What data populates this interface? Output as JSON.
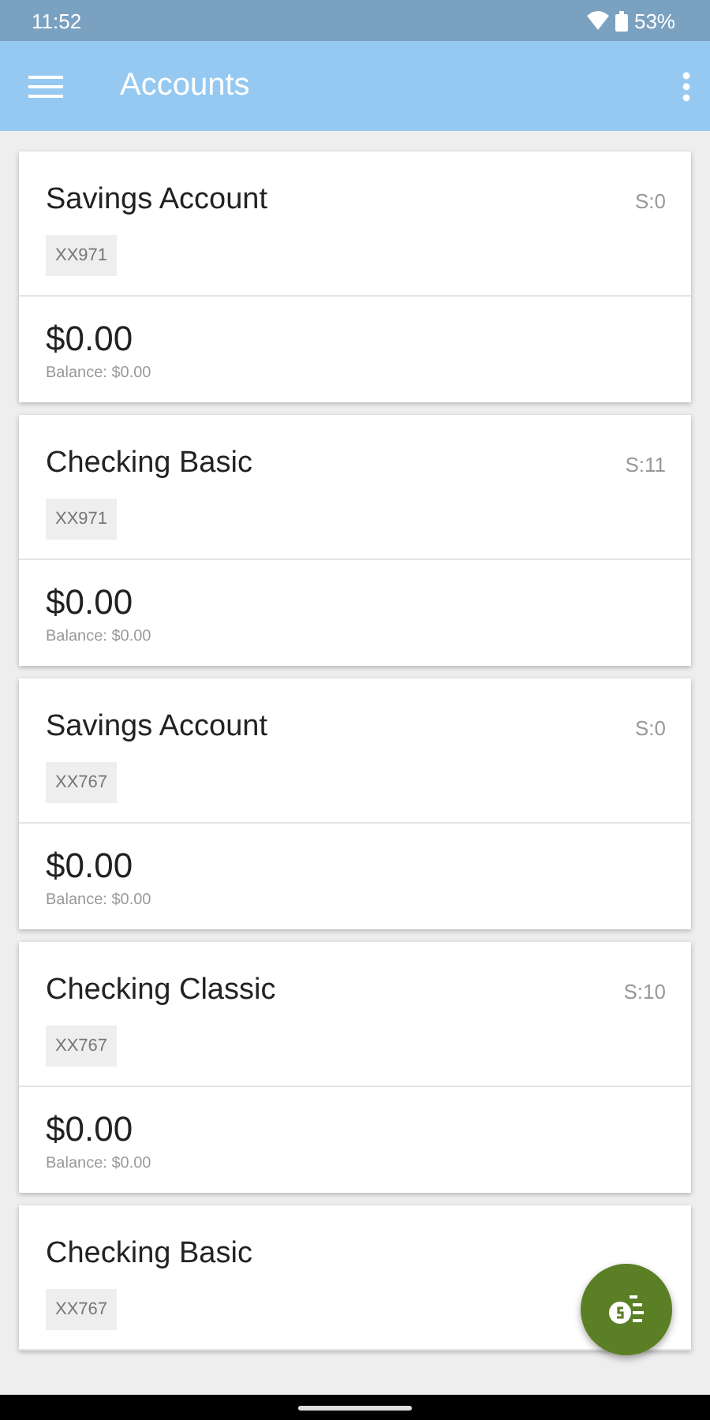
{
  "status_bar": {
    "time": "11:52",
    "battery": "53%"
  },
  "app_bar": {
    "title": "Accounts"
  },
  "accounts": [
    {
      "name": "Savings Account",
      "sync": "S:0",
      "number": "XX971",
      "amount": "$0.00",
      "balance": "Balance: $0.00"
    },
    {
      "name": "Checking Basic",
      "sync": "S:11",
      "number": "XX971",
      "amount": "$0.00",
      "balance": "Balance: $0.00"
    },
    {
      "name": "Savings Account",
      "sync": "S:0",
      "number": "XX767",
      "amount": "$0.00",
      "balance": "Balance: $0.00"
    },
    {
      "name": "Checking Classic",
      "sync": "S:10",
      "number": "XX767",
      "amount": "$0.00",
      "balance": "Balance: $0.00"
    },
    {
      "name": "Checking Basic",
      "number": "XX767"
    }
  ]
}
